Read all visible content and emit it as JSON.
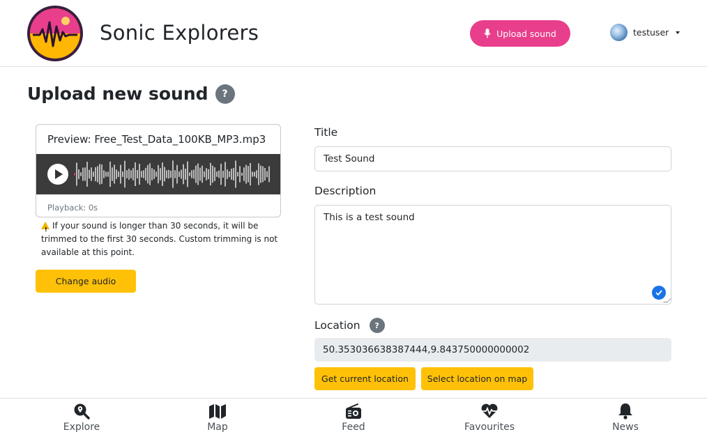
{
  "header": {
    "brand": "Sonic Explorers",
    "upload_label": "Upload sound",
    "username": "testuser"
  },
  "page": {
    "title": "Upload new sound",
    "help_symbol": "?"
  },
  "preview": {
    "title": "Preview: Free_Test_Data_100KB_MP3.mp3",
    "playback": "Playback: 0s",
    "warning": "If your sound is longer than 30 seconds, it will be trimmed to the first 30 seconds. Custom trimming is not available at this point.",
    "change_label": "Change audio"
  },
  "form": {
    "title_label": "Title",
    "title_value": "Test Sound",
    "description_label": "Description",
    "description_value": "This is a test sound",
    "location_label": "Location",
    "location_value": "50.353036638387444,9.843750000000002",
    "current_location_label": "Get current location",
    "select_on_map_label": "Select location on map"
  },
  "nav": [
    {
      "label": "Explore",
      "icon": "search-location-icon"
    },
    {
      "label": "Map",
      "icon": "map-icon"
    },
    {
      "label": "Feed",
      "icon": "radio-icon"
    },
    {
      "label": "Favourites",
      "icon": "heartbeat-icon"
    },
    {
      "label": "News",
      "icon": "bell-icon"
    }
  ],
  "colors": {
    "accent_pink": "#e83e8c",
    "accent_yellow": "#ffc107",
    "logo_purple": "#7b2a8c",
    "check_blue": "#1a73e8"
  }
}
